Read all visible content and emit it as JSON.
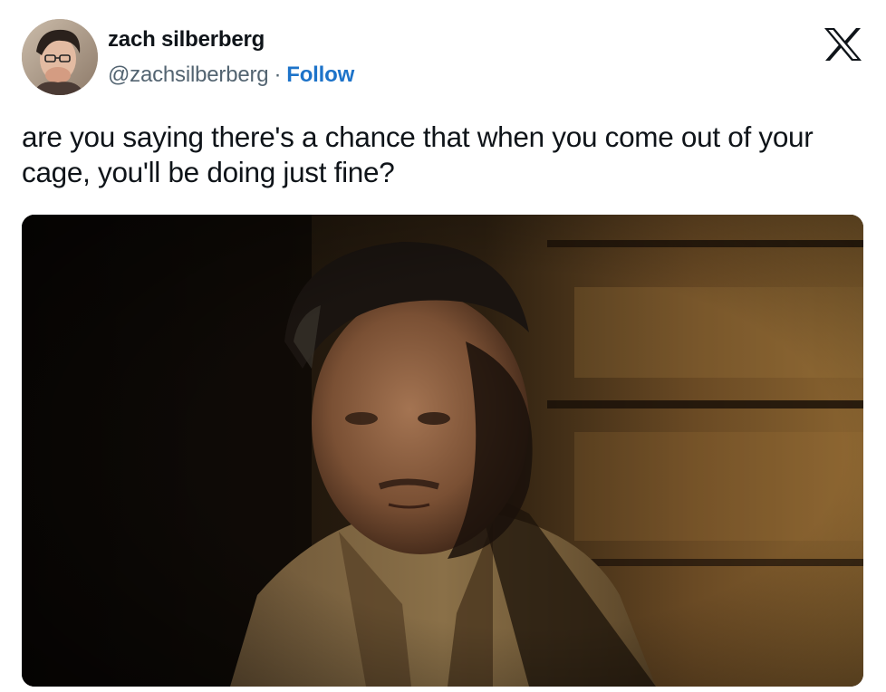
{
  "author": {
    "display_name": "zach silberberg",
    "handle": "@zachsilberberg",
    "separator": "·",
    "follow_label": "Follow"
  },
  "platform_icon": "x-logo-icon",
  "tweet": {
    "text": "are you saying there's a chance that when you come out of your cage, you'll be doing just fine?"
  },
  "media": {
    "kind": "video-still"
  },
  "colors": {
    "text": "#0f1419",
    "secondary_text": "#536471",
    "link": "#1d73c9",
    "background": "#ffffff"
  }
}
